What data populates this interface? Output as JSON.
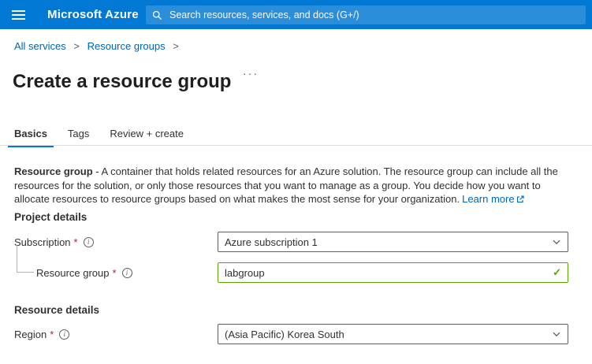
{
  "topbar": {
    "brand": "Microsoft Azure",
    "search_placeholder": "Search resources, services, and docs (G+/)"
  },
  "breadcrumb": {
    "all_services": "All services",
    "resource_groups": "Resource groups",
    "separator": ">"
  },
  "page": {
    "title": "Create a resource group",
    "more_options": "···"
  },
  "tabs": [
    {
      "label": "Basics",
      "active": true
    },
    {
      "label": "Tags",
      "active": false
    },
    {
      "label": "Review + create",
      "active": false
    }
  ],
  "description": {
    "lead": "Resource group",
    "body": " - A container that holds related resources for an Azure solution. The resource group can include all the resources for the solution, or only those resources that you want to manage as a group. You decide how you want to allocate resources to resource groups based on what makes the most sense for your organization.",
    "link_label": "Learn more"
  },
  "sections": {
    "project_details": "Project details",
    "resource_details": "Resource details"
  },
  "fields": {
    "subscription": {
      "label": "Subscription",
      "required_marker": "*",
      "value": "Azure subscription 1"
    },
    "resource_group": {
      "label": "Resource group",
      "required_marker": "*",
      "value": "labgroup"
    },
    "region": {
      "label": "Region",
      "required_marker": "*",
      "value": "(Asia Pacific) Korea South"
    }
  },
  "icons": {
    "info": "i",
    "check": "✓"
  },
  "colors": {
    "header_bg": "#0078d4",
    "link_blue": "#0065b3",
    "accent_blue": "#0078d4",
    "valid_green": "#57a300",
    "required_red": "#a4262c",
    "text": "#323130"
  }
}
